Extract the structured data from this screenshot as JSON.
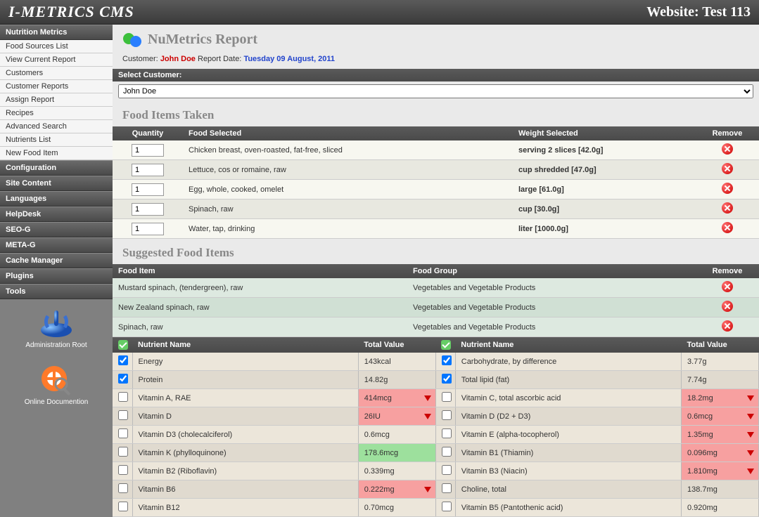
{
  "topbar": {
    "brand": "I-METRICS CMS",
    "site": "Website: Test 113"
  },
  "sidebar": {
    "sections": [
      {
        "header": "Nutrition Metrics",
        "expanded": true,
        "items": [
          "Food Sources List",
          "View Current Report",
          "Customers",
          "Customer Reports",
          "Assign Report",
          "Recipes",
          "Advanced Search",
          "Nutrients List",
          "New Food Item"
        ]
      },
      {
        "header": "Configuration"
      },
      {
        "header": "Site Content"
      },
      {
        "header": "Languages"
      },
      {
        "header": "HelpDesk"
      },
      {
        "header": "SEO-G"
      },
      {
        "header": "META-G"
      },
      {
        "header": "Cache Manager"
      },
      {
        "header": "Plugins"
      },
      {
        "header": "Tools"
      }
    ],
    "tools": [
      {
        "label": "Administration Root"
      },
      {
        "label": "Online Documention"
      }
    ]
  },
  "report": {
    "title": "NuMetrics Report",
    "customer_label": "Customer:",
    "customer": "John Doe",
    "date_label": "Report Date:",
    "date": "Tuesday 09 August, 2011",
    "select_label": "Select Customer:",
    "select_value": "John Doe"
  },
  "food_taken": {
    "title": "Food Items Taken",
    "cols": {
      "qty": "Quantity",
      "food": "Food Selected",
      "weight": "Weight Selected",
      "remove": "Remove"
    },
    "rows": [
      {
        "qty": "1",
        "food": "Chicken breast, oven-roasted, fat-free, sliced",
        "weight": "serving 2 slices [42.0g]"
      },
      {
        "qty": "1",
        "food": "Lettuce, cos or romaine, raw",
        "weight": "cup shredded [47.0g]"
      },
      {
        "qty": "1",
        "food": "Egg, whole, cooked, omelet",
        "weight": "large [61.0g]"
      },
      {
        "qty": "1",
        "food": "Spinach, raw",
        "weight": "cup [30.0g]"
      },
      {
        "qty": "1",
        "food": "Water, tap, drinking",
        "weight": "liter [1000.0g]"
      }
    ]
  },
  "suggested": {
    "title": "Suggested Food Items",
    "cols": {
      "item": "Food Item",
      "group": "Food Group",
      "remove": "Remove"
    },
    "rows": [
      {
        "item": "Mustard spinach, (tendergreen), raw",
        "group": "Vegetables and Vegetable Products"
      },
      {
        "item": "New Zealand spinach, raw",
        "group": "Vegetables and Vegetable Products"
      },
      {
        "item": "Spinach, raw",
        "group": "Vegetables and Vegetable Products"
      }
    ]
  },
  "nutrients": {
    "cols": {
      "name": "Nutrient Name",
      "value": "Total Value"
    },
    "left": [
      {
        "checked": true,
        "name": "Energy",
        "value": "143kcal",
        "flag": ""
      },
      {
        "checked": true,
        "name": "Protein",
        "value": "14.82g",
        "flag": ""
      },
      {
        "checked": false,
        "name": "Vitamin A, RAE",
        "value": "414mcg",
        "flag": "red"
      },
      {
        "checked": false,
        "name": "Vitamin D",
        "value": "26IU",
        "flag": "red"
      },
      {
        "checked": false,
        "name": "Vitamin D3 (cholecalciferol)",
        "value": "0.6mcg",
        "flag": ""
      },
      {
        "checked": false,
        "name": "Vitamin K (phylloquinone)",
        "value": "178.6mcg",
        "flag": "green"
      },
      {
        "checked": false,
        "name": "Vitamin B2 (Riboflavin)",
        "value": "0.339mg",
        "flag": ""
      },
      {
        "checked": false,
        "name": "Vitamin B6",
        "value": "0.222mg",
        "flag": "red"
      },
      {
        "checked": false,
        "name": "Vitamin B12",
        "value": "0.70mcg",
        "flag": ""
      }
    ],
    "right": [
      {
        "checked": true,
        "name": "Carbohydrate, by difference",
        "value": "3.77g",
        "flag": ""
      },
      {
        "checked": true,
        "name": "Total lipid (fat)",
        "value": "7.74g",
        "flag": ""
      },
      {
        "checked": false,
        "name": "Vitamin C, total ascorbic acid",
        "value": "18.2mg",
        "flag": "red"
      },
      {
        "checked": false,
        "name": "Vitamin D (D2 + D3)",
        "value": "0.6mcg",
        "flag": "red"
      },
      {
        "checked": false,
        "name": "Vitamin E (alpha-tocopherol)",
        "value": "1.35mg",
        "flag": "red"
      },
      {
        "checked": false,
        "name": "Vitamin B1 (Thiamin)",
        "value": "0.096mg",
        "flag": "red"
      },
      {
        "checked": false,
        "name": "Vitamin B3 (Niacin)",
        "value": "1.810mg",
        "flag": "red"
      },
      {
        "checked": false,
        "name": "Choline, total",
        "value": "138.7mg",
        "flag": ""
      },
      {
        "checked": false,
        "name": "Vitamin B5 (Pantothenic acid)",
        "value": "0.920mg",
        "flag": ""
      }
    ]
  }
}
